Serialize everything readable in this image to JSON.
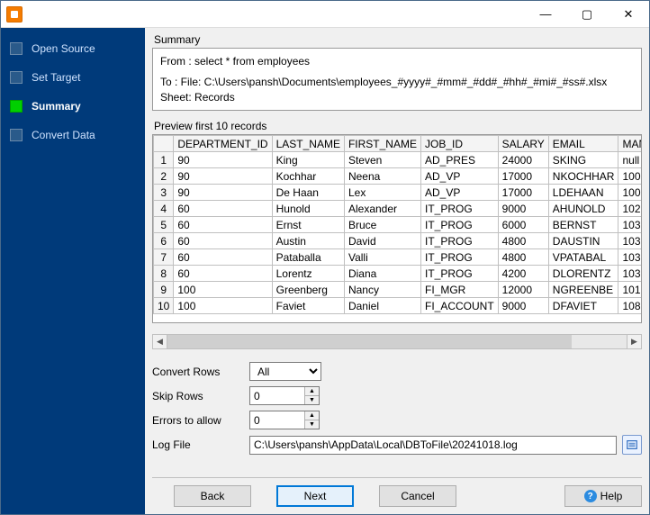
{
  "window": {
    "min_icon": "—",
    "max_icon": "▢",
    "close_icon": "✕"
  },
  "steps": [
    {
      "label": "Open Source"
    },
    {
      "label": "Set Target"
    },
    {
      "label": "Summary"
    },
    {
      "label": "Convert Data"
    }
  ],
  "summary": {
    "title": "Summary",
    "from": "From : select * from employees",
    "to": "To : File: C:\\Users\\pansh\\Documents\\employees_#yyyy#_#mm#_#dd#_#hh#_#mi#_#ss#.xlsx Sheet: Records"
  },
  "preview": {
    "title": "Preview first 10 records",
    "headers": [
      "DEPARTMENT_ID",
      "LAST_NAME",
      "FIRST_NAME",
      "JOB_ID",
      "SALARY",
      "EMAIL",
      "MANAG"
    ],
    "rows": [
      [
        "90",
        "King",
        "Steven",
        "AD_PRES",
        "24000",
        "SKING",
        "null"
      ],
      [
        "90",
        "Kochhar",
        "Neena",
        "AD_VP",
        "17000",
        "NKOCHHAR",
        "100"
      ],
      [
        "90",
        "De Haan",
        "Lex",
        "AD_VP",
        "17000",
        "LDEHAAN",
        "100"
      ],
      [
        "60",
        "Hunold",
        "Alexander",
        "IT_PROG",
        "9000",
        "AHUNOLD",
        "102"
      ],
      [
        "60",
        "Ernst",
        "Bruce",
        "IT_PROG",
        "6000",
        "BERNST",
        "103"
      ],
      [
        "60",
        "Austin",
        "David",
        "IT_PROG",
        "4800",
        "DAUSTIN",
        "103"
      ],
      [
        "60",
        "Pataballa",
        "Valli",
        "IT_PROG",
        "4800",
        "VPATABAL",
        "103"
      ],
      [
        "60",
        "Lorentz",
        "Diana",
        "IT_PROG",
        "4200",
        "DLORENTZ",
        "103"
      ],
      [
        "100",
        "Greenberg",
        "Nancy",
        "FI_MGR",
        "12000",
        "NGREENBE",
        "101"
      ],
      [
        "100",
        "Faviet",
        "Daniel",
        "FI_ACCOUNT",
        "9000",
        "DFAVIET",
        "108"
      ]
    ]
  },
  "form": {
    "convert_rows_label": "Convert Rows",
    "convert_rows_value": "All",
    "skip_rows_label": "Skip Rows",
    "skip_rows_value": "0",
    "errors_label": "Errors to allow",
    "errors_value": "0",
    "log_label": "Log File",
    "log_value": "C:\\Users\\pansh\\AppData\\Local\\DBToFile\\20241018.log"
  },
  "footer": {
    "back": "Back",
    "next": "Next",
    "cancel": "Cancel",
    "help": "Help"
  }
}
